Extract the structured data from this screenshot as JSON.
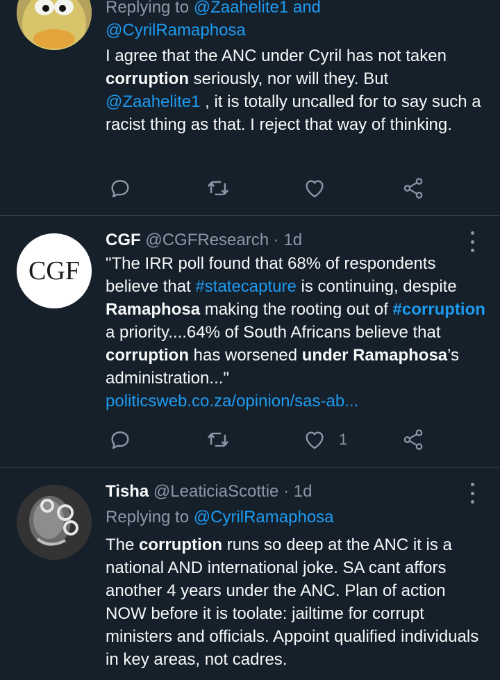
{
  "tweets": [
    {
      "reply_prefix": "Replying to",
      "reply_mentions_1": "@Zaahelite1 and",
      "reply_mentions_2": "@CyrilRamaphosa",
      "body": {
        "p1": "I agree that the ANC under Cyril has not taken",
        "p2_bold": "corruption",
        "p3": " seriously, nor will they. But",
        "mention": "@Zaahelite1",
        "p4": " , it is totally uncalled for to say such a racist thing as that. I reject that way of thinking."
      },
      "likes": ""
    },
    {
      "name": "CGF",
      "handle": "@CGFResearch",
      "dot": "·",
      "time": "1d",
      "avatar_text": "CGF",
      "body": {
        "s1": "\"The IRR poll found that 68% of respondents believe that ",
        "h1": "#statecapture",
        "s2": " is continuing, despite ",
        "b1": "Ramaphosa",
        "s3": " making the rooting out of ",
        "h2": "#corruption",
        "s4": " a priority....64% of South Africans believe that ",
        "b2": "corruption",
        "s5": " has worsened ",
        "b3": "under Ramaphosa",
        "s6": "’s administration...\"",
        "link": "politicsweb.co.za/opinion/sas-ab..."
      },
      "likes": "1"
    },
    {
      "name": "Tisha",
      "handle": "@LeaticiaScottie",
      "dot": "·",
      "time": "1d",
      "reply_prefix": "Replying to",
      "reply_mention": "@CyrilRamaphosa",
      "body": {
        "s1": "The ",
        "b1": "corruption",
        "s2": " runs so deep at the ANC it is a national AND international joke.  SA cant affors another 4 years under the ANC.  Plan of action NOW before it is toolate: jailtime for corrupt ministers and officials. Appoint qualified individuals in key areas, not cadres."
      }
    }
  ],
  "icons": {
    "reply": "reply-icon",
    "retweet": "retweet-icon",
    "like": "heart-icon",
    "share": "share-icon",
    "more": "more-icon"
  },
  "colors": {
    "background": "#15202b",
    "accent": "#1d9bf0",
    "secondary_text": "#8b98a5",
    "divider": "#38444d"
  }
}
